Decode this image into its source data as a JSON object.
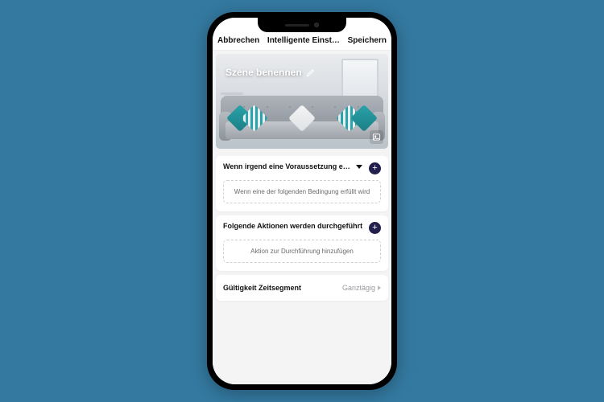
{
  "navbar": {
    "cancel": "Abbrechen",
    "title": "Intelligente Einst…",
    "save": "Speichern"
  },
  "hero": {
    "scene_name_label": "Szene benennen",
    "edit_icon": "pencil-icon",
    "change_image_icon": "image-icon"
  },
  "condition_card": {
    "title": "Wenn irgend eine Voraussetzung e…",
    "add_icon": "plus-icon",
    "placeholder": "Wenn eine der folgenden Bedingung erfüllt wird"
  },
  "action_card": {
    "title": "Folgende Aktionen werden durchgeführt",
    "add_icon": "plus-icon",
    "placeholder": "Aktion zur Durchführung hinzufügen"
  },
  "validity_row": {
    "label": "Gültigkeit Zeitsegment",
    "value": "Ganztägig"
  },
  "colors": {
    "background": "#3479a0",
    "accent": "#231f4d",
    "teal": "#2aa3aa"
  }
}
